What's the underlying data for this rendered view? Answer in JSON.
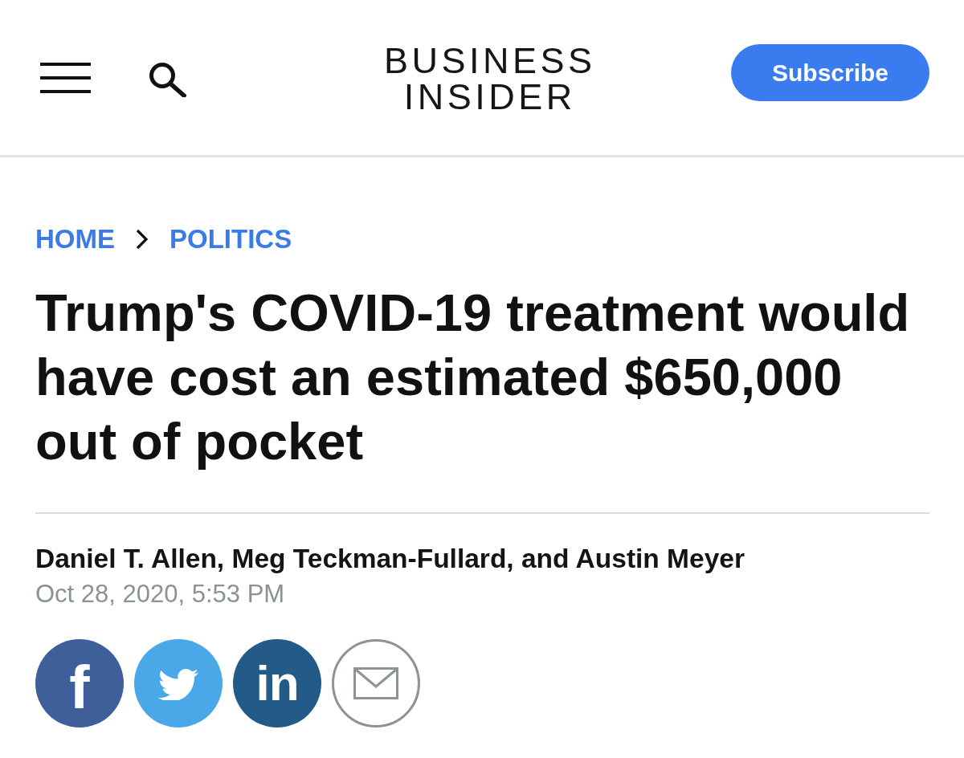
{
  "header": {
    "logo_lines": [
      "BUSINESS",
      "INSIDER"
    ],
    "subscribe_button": "Subscribe"
  },
  "breadcrumb": [
    {
      "label": "HOME"
    },
    {
      "label": "POLITICS"
    }
  ],
  "article": {
    "headline": "Trump's COVID-19 treatment would have cost an estimated $650,000 out of pocket",
    "byline": "Daniel T. Allen, Meg Teckman-Fullard, and Austin Meyer",
    "date": "Oct 28, 2020, 5:53 PM"
  },
  "share_buttons": [
    {
      "kind": "facebook",
      "label": "f"
    },
    {
      "kind": "twitter"
    },
    {
      "kind": "linkedin",
      "label": "in"
    },
    {
      "kind": "email"
    }
  ]
}
